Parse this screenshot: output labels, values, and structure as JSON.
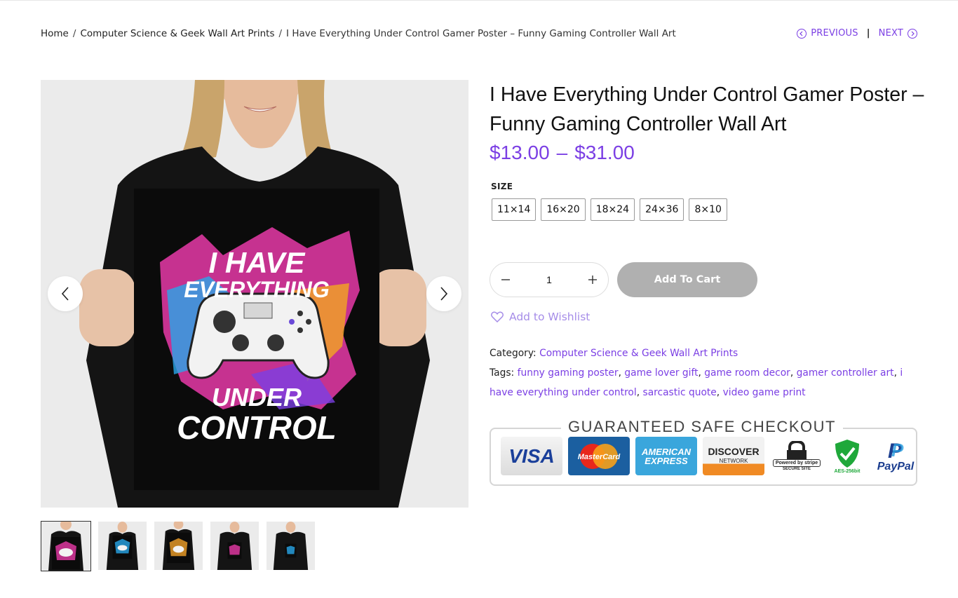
{
  "breadcrumb": {
    "home": "Home",
    "category": "Computer Science & Geek Wall Art Prints",
    "current": "I Have Everything Under Control Gamer Poster – Funny Gaming Controller Wall Art",
    "separator": "/"
  },
  "pager": {
    "previous": "PREVIOUS",
    "next": "NEXT",
    "divider": "|"
  },
  "product": {
    "title": "I Have Everything Under Control Gamer Poster – Funny Gaming Controller Wall Art",
    "price_min": "$13.00",
    "price_dash": "–",
    "price_max": "$31.00",
    "poster_text": {
      "line1": "I HAVE",
      "line2": "EVERYTHING",
      "line3": "UNDER",
      "line4": "CONTROL"
    }
  },
  "size": {
    "label": "SIZE",
    "options": [
      "11×14",
      "16×20",
      "18×24",
      "24×36",
      "8×10"
    ]
  },
  "cart": {
    "quantity": "1",
    "add_label": "Add To Cart",
    "wishlist_label": "Add to Wishlist"
  },
  "meta": {
    "category_label": "Category:",
    "category_value": "Computer Science & Geek Wall Art Prints",
    "tags_label": "Tags:",
    "tags": [
      "funny gaming poster",
      "game lover gift",
      "game room decor",
      "gamer controller art",
      "i have everything under control",
      "sarcastic quote",
      "video game print"
    ]
  },
  "checkout_badge": {
    "title": "GUARANTEED SAFE CHECKOUT",
    "visa": "VISA",
    "mastercard": "MasterCard",
    "amex_line1": "AMERICAN",
    "amex_line2": "EXPRESS",
    "discover": "DISCOVER",
    "discover_sub": "NETWORK",
    "stripe": "Powered by stripe",
    "stripe_sub": "SECURE SITE",
    "aes": "AES-256bit",
    "paypal": "PayPal"
  },
  "colors": {
    "accent": "#7b3fe4",
    "cart_button": "#b0b0b0",
    "wishlist": "#a68de8"
  }
}
